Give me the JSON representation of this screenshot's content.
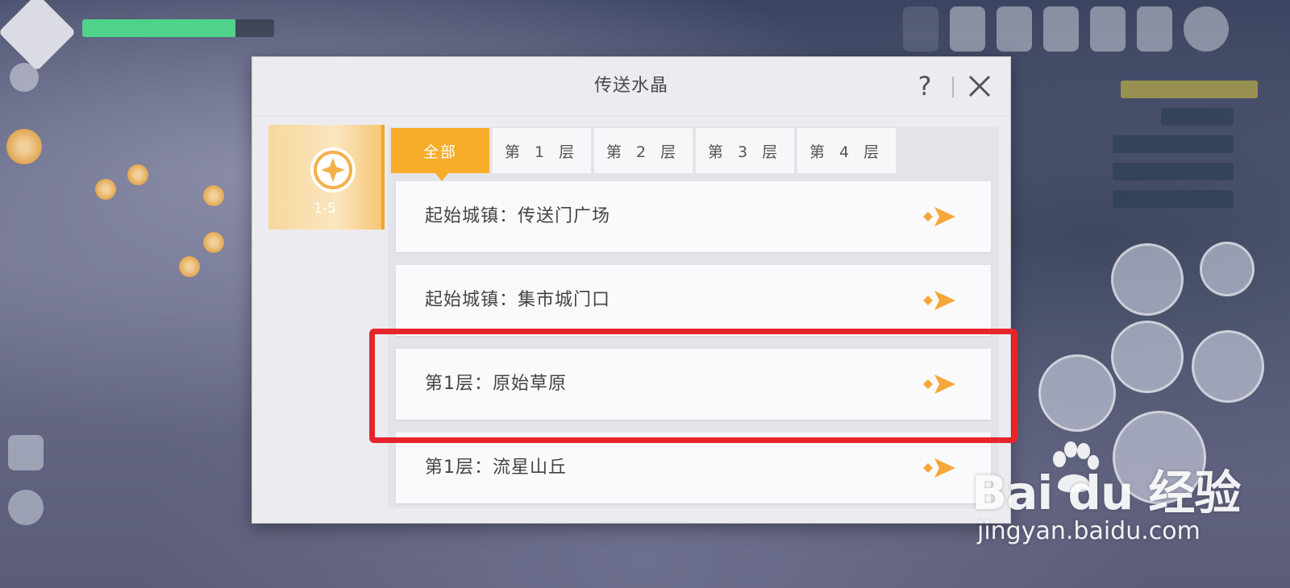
{
  "dialog": {
    "title": "传送水晶",
    "help_label": "?",
    "side_tab": {
      "label": "1-5"
    },
    "tabs": [
      {
        "label": "全部",
        "active": true
      },
      {
        "label": "第 1 层",
        "active": false
      },
      {
        "label": "第 2 层",
        "active": false
      },
      {
        "label": "第 3 层",
        "active": false
      },
      {
        "label": "第 4 层",
        "active": false
      }
    ],
    "teleports": [
      {
        "label": "起始城镇：传送门广场"
      },
      {
        "label": "起始城镇：集市城门口"
      },
      {
        "label": "第1层：原始草原",
        "highlighted": true
      },
      {
        "label": "第1层：流星山丘"
      }
    ]
  },
  "hud": {
    "hp_fraction": 0.8
  },
  "watermark": {
    "brand": "Bai du 经验",
    "url": "jingyan.baidu.com"
  },
  "colors": {
    "accent": "#f7ac2a",
    "highlight": "#e8242b",
    "arrow": "#f5a73a"
  }
}
